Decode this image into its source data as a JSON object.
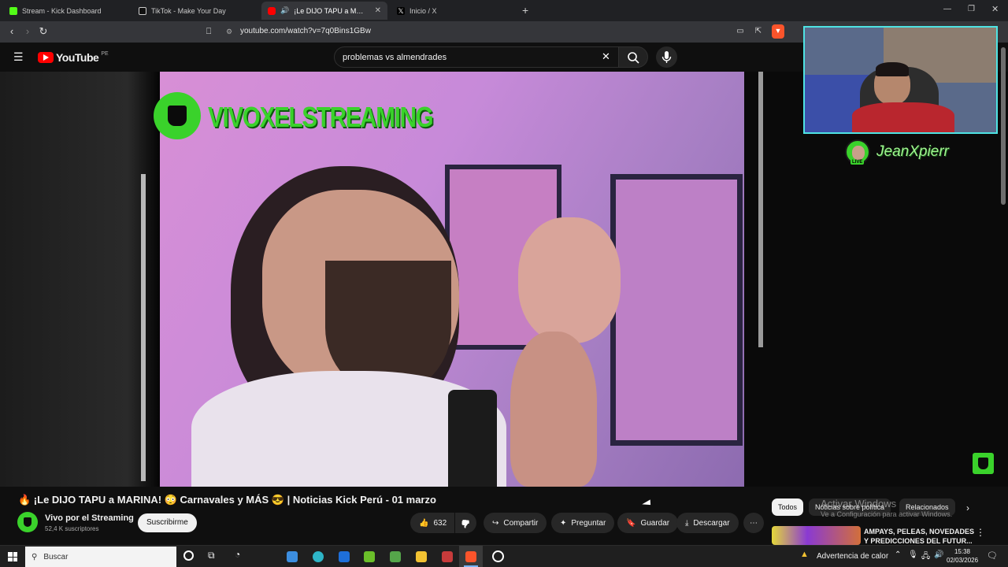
{
  "browser": {
    "tabs": [
      {
        "label": "Stream - Kick Dashboard",
        "active": false
      },
      {
        "label": "TikTok - Make Your Day",
        "active": false
      },
      {
        "label": "¡Le DIJO TAPU a MARINA!",
        "active": true
      },
      {
        "label": "Inicio / X",
        "active": false
      }
    ],
    "new_tab": "+",
    "url": "youtube.com/watch?v=7q0Bins1GBw"
  },
  "youtube": {
    "logo": "YouTube",
    "region": "PE",
    "search_value": "problemas vs almendrades"
  },
  "video": {
    "watermark": "VIVOXELSTREAMING",
    "overlay_name": "JeanXpierr",
    "overlay_live": "LIVE",
    "title": "🔥 ¡Le DIJO TAPU a MARINA! 😳 Carnavales y MÁS 😎 | Noticias Kick Perú - 01 marzo"
  },
  "channel": {
    "name": "Vivo por el Streaming",
    "subs": "52,4 K suscriptores",
    "subscribe": "Suscribirme"
  },
  "actions": {
    "likes": "632",
    "share": "Compartir",
    "ask": "Preguntar",
    "save": "Guardar",
    "download": "Descargar",
    "more": "⋯"
  },
  "sidebar": {
    "chips": [
      "Todos",
      "Noticias sobre política",
      "Relacionados"
    ],
    "activation_title": "Activar Windows",
    "activation_sub": "Ve a Configuración para activar Windows.",
    "rec_title_1": "AMPAYS, PELEAS, NOVEDADES",
    "rec_title_2": "Y PREDICCIONES DEL FUTUR..."
  },
  "taskbar": {
    "search": "Buscar",
    "weather": "Advertencia de calor",
    "time": "15:38",
    "date": "02/03/2026"
  },
  "colors": {
    "accent_red": "#ff0000",
    "cam_border": "#4ee3e3",
    "neon_green": "#3ad22b"
  }
}
